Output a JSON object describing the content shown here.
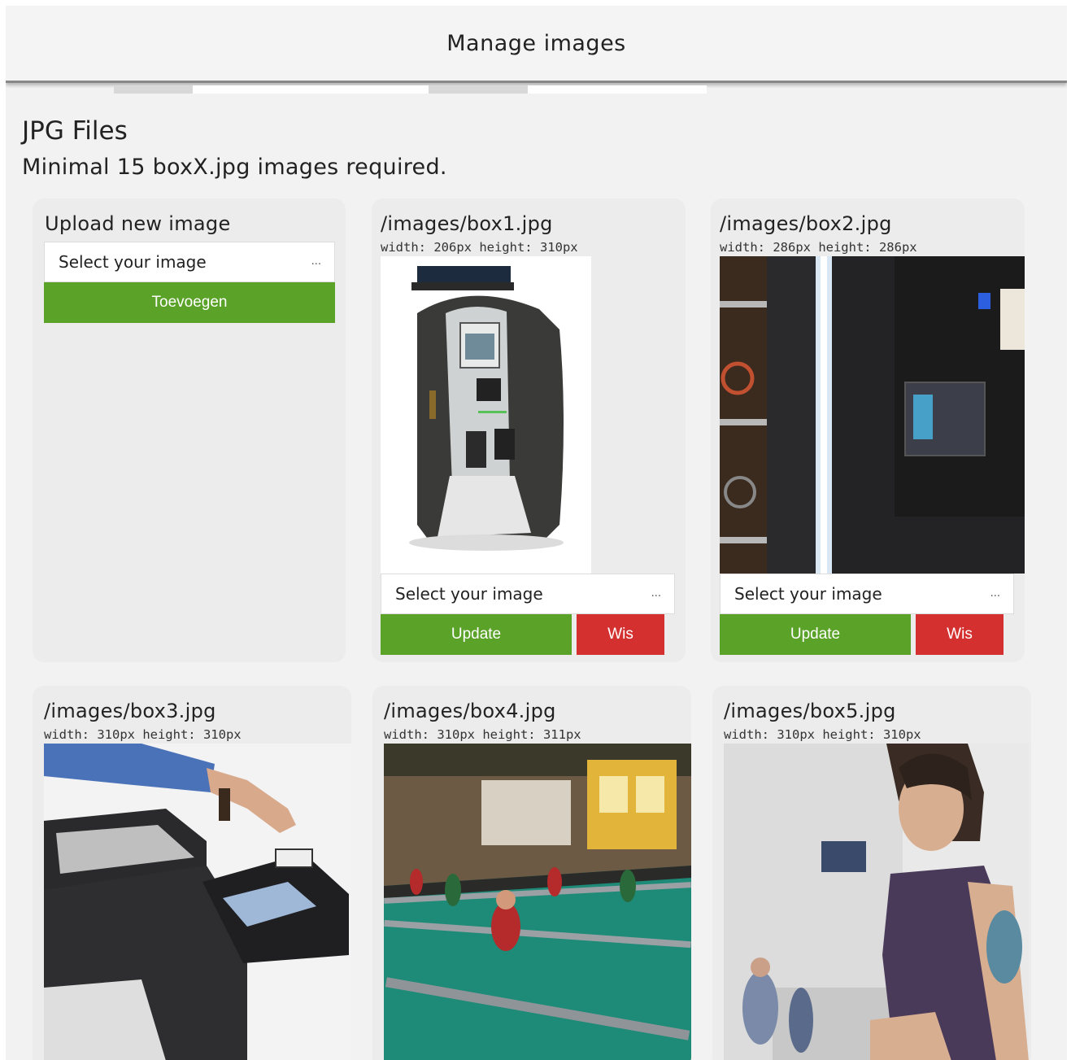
{
  "header": {
    "title": "Manage images"
  },
  "section": {
    "title": "JPG Files",
    "subtitle": "Minimal 15 boxX.jpg images required."
  },
  "upload_card": {
    "title": "Upload new image",
    "file_placeholder": "Select your image",
    "dots": "...",
    "add_button": "Toevoegen"
  },
  "images": [
    {
      "path": "/images/box1.jpg",
      "dims": "width: 206px height: 310px",
      "file_placeholder": "Select your image",
      "dots": "...",
      "update_button": "Update",
      "delete_button": "Wis",
      "icon": "payment-kiosk-photo"
    },
    {
      "path": "/images/box2.jpg",
      "dims": "width: 286px height: 286px",
      "file_placeholder": "Select your image",
      "dots": "...",
      "update_button": "Update",
      "delete_button": "Wis",
      "icon": "vending-machine-photo"
    },
    {
      "path": "/images/box3.jpg",
      "dims": "width: 310px height: 310px",
      "icon": "printer-card-reader-photo"
    },
    {
      "path": "/images/box4.jpg",
      "dims": "width: 310px height: 311px",
      "icon": "foosball-table-photo"
    },
    {
      "path": "/images/box5.jpg",
      "dims": "width: 310px height: 310px",
      "icon": "smiling-woman-photo"
    }
  ],
  "colors": {
    "green": "#5aa228",
    "red": "#d3302f",
    "card_bg": "#ececec",
    "page_bg": "#f2f2f2"
  }
}
